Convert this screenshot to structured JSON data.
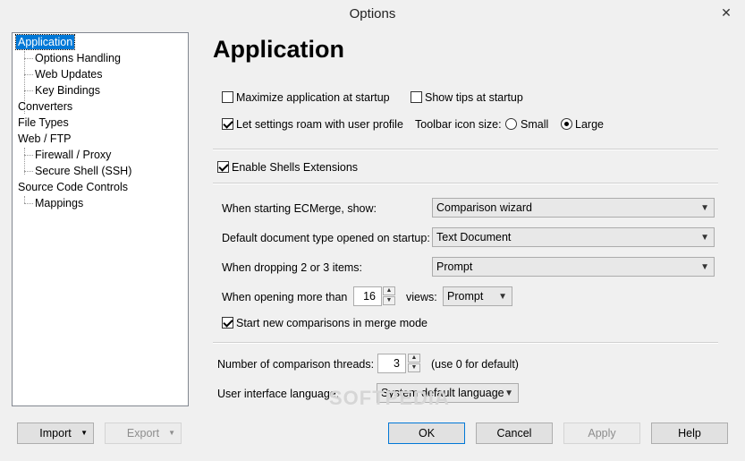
{
  "window": {
    "title": "Options",
    "close_glyph": "✕"
  },
  "tree": {
    "items": [
      {
        "label": "Application",
        "level": 0,
        "selected": true
      },
      {
        "label": "Options Handling",
        "level": 1
      },
      {
        "label": "Web Updates",
        "level": 1
      },
      {
        "label": "Key Bindings",
        "level": 1
      },
      {
        "label": "Converters",
        "level": 0
      },
      {
        "label": "File Types",
        "level": 0
      },
      {
        "label": "Web / FTP",
        "level": 0
      },
      {
        "label": "Firewall / Proxy",
        "level": 1
      },
      {
        "label": "Secure Shell (SSH)",
        "level": 1
      },
      {
        "label": "Source Code Controls",
        "level": 0
      },
      {
        "label": "Mappings",
        "level": 1
      }
    ]
  },
  "page": {
    "heading": "Application"
  },
  "options": {
    "maximize": {
      "label": "Maximize application at startup",
      "checked": false
    },
    "show_tips": {
      "label": "Show tips at startup",
      "checked": false
    },
    "roam": {
      "label": "Let settings roam with user profile",
      "checked": true
    },
    "toolbar_icon_size": {
      "label": "Toolbar icon size:",
      "small": "Small",
      "large": "Large",
      "selected": "Large"
    },
    "shell_ext": {
      "label": "Enable Shells Extensions",
      "checked": true
    },
    "startup_show": {
      "label": "When starting ECMerge, show:",
      "value": "Comparison wizard"
    },
    "default_doc": {
      "label": "Default document type opened on startup:",
      "value": "Text Document"
    },
    "dropping": {
      "label": "When dropping 2 or 3 items:",
      "value": "Prompt"
    },
    "opening_more": {
      "label": "When opening more than",
      "value": "16",
      "views_label": "views:",
      "views_value": "Prompt"
    },
    "merge_mode": {
      "label": "Start new comparisons in merge mode",
      "checked": true
    },
    "threads": {
      "label": "Number of comparison threads:",
      "value": "3",
      "hint": "(use 0 for default)"
    },
    "language": {
      "label": "User interface language:",
      "value": "System default language"
    }
  },
  "buttons": {
    "import": "Import",
    "export": "Export",
    "ok": "OK",
    "cancel": "Cancel",
    "apply": "Apply",
    "help": "Help"
  },
  "watermark": "SOFTPEDIA",
  "colors": {
    "selection": "#0078d7",
    "default_button_border": "#0078d7"
  }
}
